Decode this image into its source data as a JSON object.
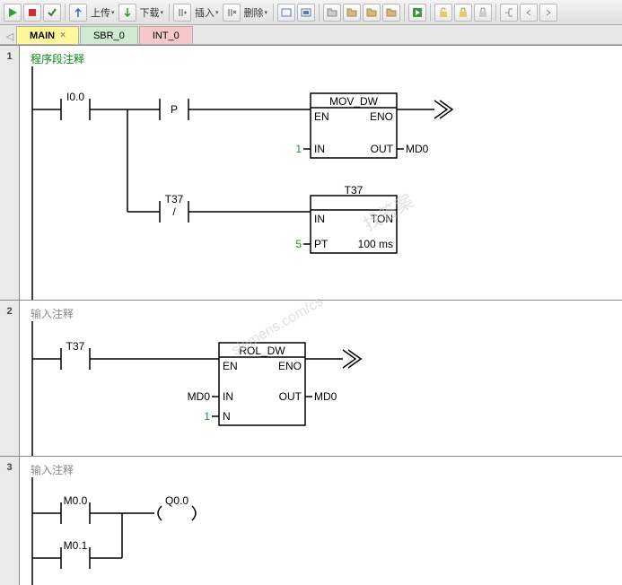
{
  "toolbar": {
    "upload_label": "上传",
    "download_label": "下载",
    "insert_label": "插入",
    "delete_label": "删除"
  },
  "tabs": {
    "main": "MAIN",
    "sbr": "SBR_0",
    "int": "INT_0"
  },
  "networks": [
    {
      "num": "1",
      "comment": "程序段注释",
      "rungs": {
        "contact1": "I0.0",
        "pulse": "P",
        "block1_name": "MOV_DW",
        "block1_en": "EN",
        "block1_eno": "ENO",
        "block1_in": "IN",
        "block1_out": "OUT",
        "block1_in_val": "1",
        "block1_out_val": "MD0",
        "contact2": "T37",
        "contact2_sym": "/",
        "block2_name": "T37",
        "block2_in": "IN",
        "block2_ton": "TON",
        "block2_pt": "PT",
        "block2_time": "100 ms",
        "block2_pt_val": "5"
      }
    },
    {
      "num": "2",
      "comment": "输入注释",
      "rungs": {
        "contact1": "T37",
        "block1_name": "ROL_DW",
        "block1_en": "EN",
        "block1_eno": "ENO",
        "block1_in": "IN",
        "block1_out": "OUT",
        "block1_in_val": "MD0",
        "block1_out_val": "MD0",
        "block1_n": "N",
        "block1_n_val": "1"
      }
    },
    {
      "num": "3",
      "comment": "输入注释",
      "rungs": {
        "contact1": "M0.0",
        "contact2": "M0.1",
        "coil": "Q0.0"
      }
    }
  ],
  "watermark": {
    "line1": "找答案",
    "line2": "siemens.com/cs"
  }
}
